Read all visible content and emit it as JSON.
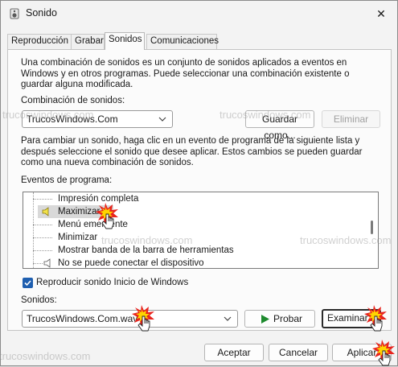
{
  "window": {
    "title": "Sonido",
    "close_glyph": "✕"
  },
  "tabs": [
    {
      "label": "Reproducción",
      "active": false
    },
    {
      "label": "Grabar",
      "active": false
    },
    {
      "label": "Sonidos",
      "active": true
    },
    {
      "label": "Comunicaciones",
      "active": false
    }
  ],
  "intro_text": "Una combinación de sonidos es un conjunto de sonidos aplicados a eventos en Windows y en otros programas. Puede seleccionar una combinación existente o guardar alguna modificada.",
  "scheme": {
    "label": "Combinación de sonidos:",
    "value": "TrucosWindows.Com",
    "save_as_button": "Guardar como...",
    "delete_button": "Eliminar"
  },
  "change_text": "Para cambiar un sonido, haga clic en un evento de programa de la siguiente lista y después seleccione el sonido que desee aplicar. Estos cambios se pueden guardar como una nueva combinación de sonidos.",
  "events": {
    "label": "Eventos de programa:",
    "items": [
      {
        "label": "Impresión completa",
        "has_sound": false,
        "selected": false
      },
      {
        "label": "Maximizar",
        "has_sound": true,
        "selected": true
      },
      {
        "label": "Menú emergente",
        "has_sound": false,
        "selected": false
      },
      {
        "label": "Minimizar",
        "has_sound": false,
        "selected": false
      },
      {
        "label": "Mostrar banda de la barra de herramientas",
        "has_sound": false,
        "selected": false
      },
      {
        "label": "No se puede conectar el dispositivo",
        "has_sound": true,
        "selected": false
      }
    ]
  },
  "startup_checkbox": {
    "label": "Reproducir sonido Inicio de Windows",
    "checked": true
  },
  "sounds": {
    "label": "Sonidos:",
    "value": "TrucosWindows.Com.wav",
    "test_button": "Probar",
    "browse_button": "Examinar..."
  },
  "footer": {
    "ok": "Aceptar",
    "cancel": "Cancelar",
    "apply": "Aplicar"
  },
  "watermark": "trucoswindows.com",
  "colors": {
    "accent": "#1f5fb0",
    "play_green": "#1e8a2e",
    "cursor_star": "#e8231d"
  }
}
